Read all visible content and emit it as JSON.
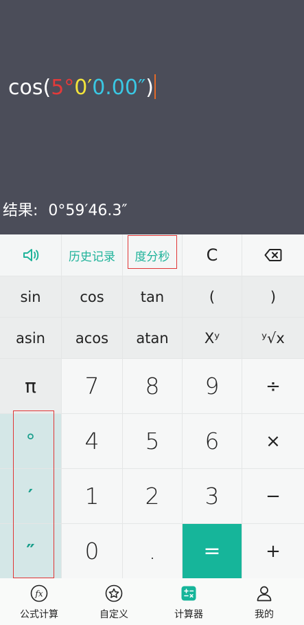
{
  "display": {
    "expression": {
      "func": "cos(",
      "deg_value": "5",
      "deg_mark": "°",
      "min_value": "0",
      "min_mark": "′",
      "sec_value": "0.00",
      "sec_mark": "″",
      "close": ")"
    },
    "result_label": "结果:",
    "result_value": "0°59′46.3″"
  },
  "toolbar": {
    "history": "历史记录",
    "dms": "度分秒",
    "clear": "C"
  },
  "keys": {
    "sin": "sin",
    "cos": "cos",
    "tan": "tan",
    "lparen": "(",
    "rparen": ")",
    "asin": "asin",
    "acos": "acos",
    "atan": "atan",
    "power": "Xʸ",
    "root": "ʸ√x",
    "pi": "π",
    "seven": "7",
    "eight": "8",
    "nine": "9",
    "divide": "÷",
    "degree": "°",
    "four": "4",
    "five": "5",
    "six": "6",
    "multiply": "×",
    "minute": "′",
    "one": "1",
    "two": "2",
    "three": "3",
    "minus": "−",
    "second": "″",
    "zero": "0",
    "dot": ".",
    "equals": "=",
    "plus": "+"
  },
  "nav": {
    "formula": "公式计算",
    "custom": "自定义",
    "calculator": "计算器",
    "mine": "我的"
  },
  "colors": {
    "display_bg": "#4b4d59",
    "accent": "#16b59a",
    "deg_color": "#e23a3a",
    "min_color": "#f2e33b",
    "sec_color": "#3ac7e3"
  }
}
